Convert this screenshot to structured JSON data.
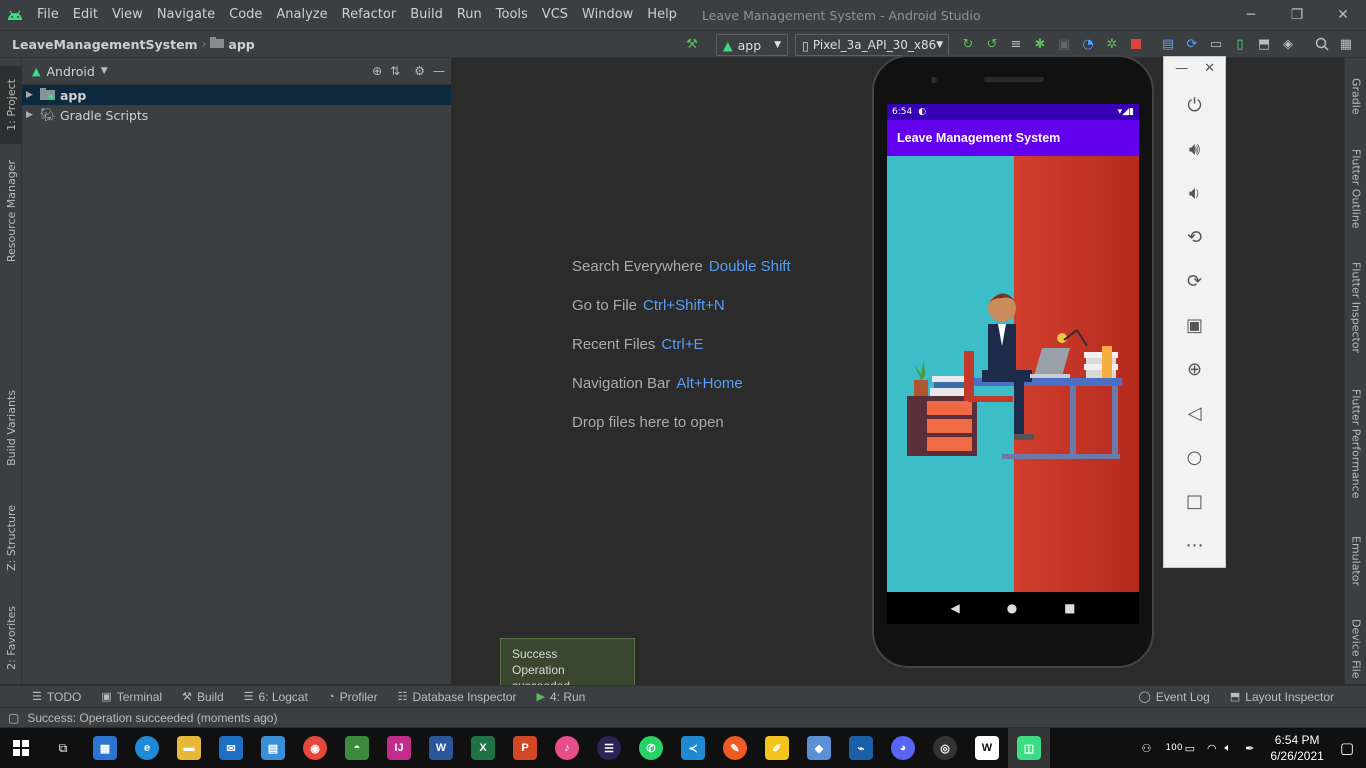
{
  "menubar": {
    "items": [
      "File",
      "Edit",
      "View",
      "Navigate",
      "Code",
      "Analyze",
      "Refactor",
      "Build",
      "Run",
      "Tools",
      "VCS",
      "Window",
      "Help"
    ],
    "title": "Leave Management System - Android Studio",
    "minimize": "─",
    "restore": "❐",
    "close": "✕"
  },
  "navbar": {
    "project": "LeaveManagementSystem",
    "module": "app",
    "run_config": "app",
    "device": "Pixel_3a_API_30_x86"
  },
  "left_tabs": {
    "project": "1: Project",
    "resource_manager": "Resource Manager",
    "build_variants": "Build Variants",
    "structure": "Z: Structure",
    "favorites": "2: Favorites"
  },
  "right_tabs": {
    "gradle": "Gradle",
    "flutter_outline": "Flutter Outline",
    "flutter_inspector": "Flutter Inspector",
    "flutter_performance": "Flutter Performance",
    "emulator": "Emulator",
    "device_file": "Device File"
  },
  "project_panel": {
    "view": "Android",
    "tree": [
      {
        "label": "app",
        "selected": true
      },
      {
        "label": "Gradle Scripts",
        "selected": false
      }
    ]
  },
  "editor_hints": [
    {
      "label": "Search Everywhere",
      "key": "Double Shift"
    },
    {
      "label": "Go to File",
      "key": "Ctrl+Shift+N"
    },
    {
      "label": "Recent Files",
      "key": "Ctrl+E"
    },
    {
      "label": "Navigation Bar",
      "key": "Alt+Home"
    },
    {
      "label": "Drop files here to open",
      "key": ""
    }
  ],
  "emulator": {
    "time": "6:54",
    "app_title": "Leave Management System",
    "colors": {
      "status": "#3700b3",
      "appbar": "#6200ee",
      "teal": "#3cbdc8",
      "red": "#c4342a"
    }
  },
  "toast": {
    "title": "Success",
    "message": "Operation succeeded"
  },
  "bottom_tabs": {
    "todo": "TODO",
    "terminal": "Terminal",
    "build": "Build",
    "logcat": "6: Logcat",
    "profiler": "Profiler",
    "database_inspector": "Database Inspector",
    "run": "4: Run",
    "event_log": "Event Log",
    "layout_inspector": "Layout Inspector"
  },
  "status_line": "Success: Operation succeeded (moments ago)",
  "taskbar": {
    "time": "6:54 PM",
    "date": "6/26/2021",
    "battery": "100"
  }
}
